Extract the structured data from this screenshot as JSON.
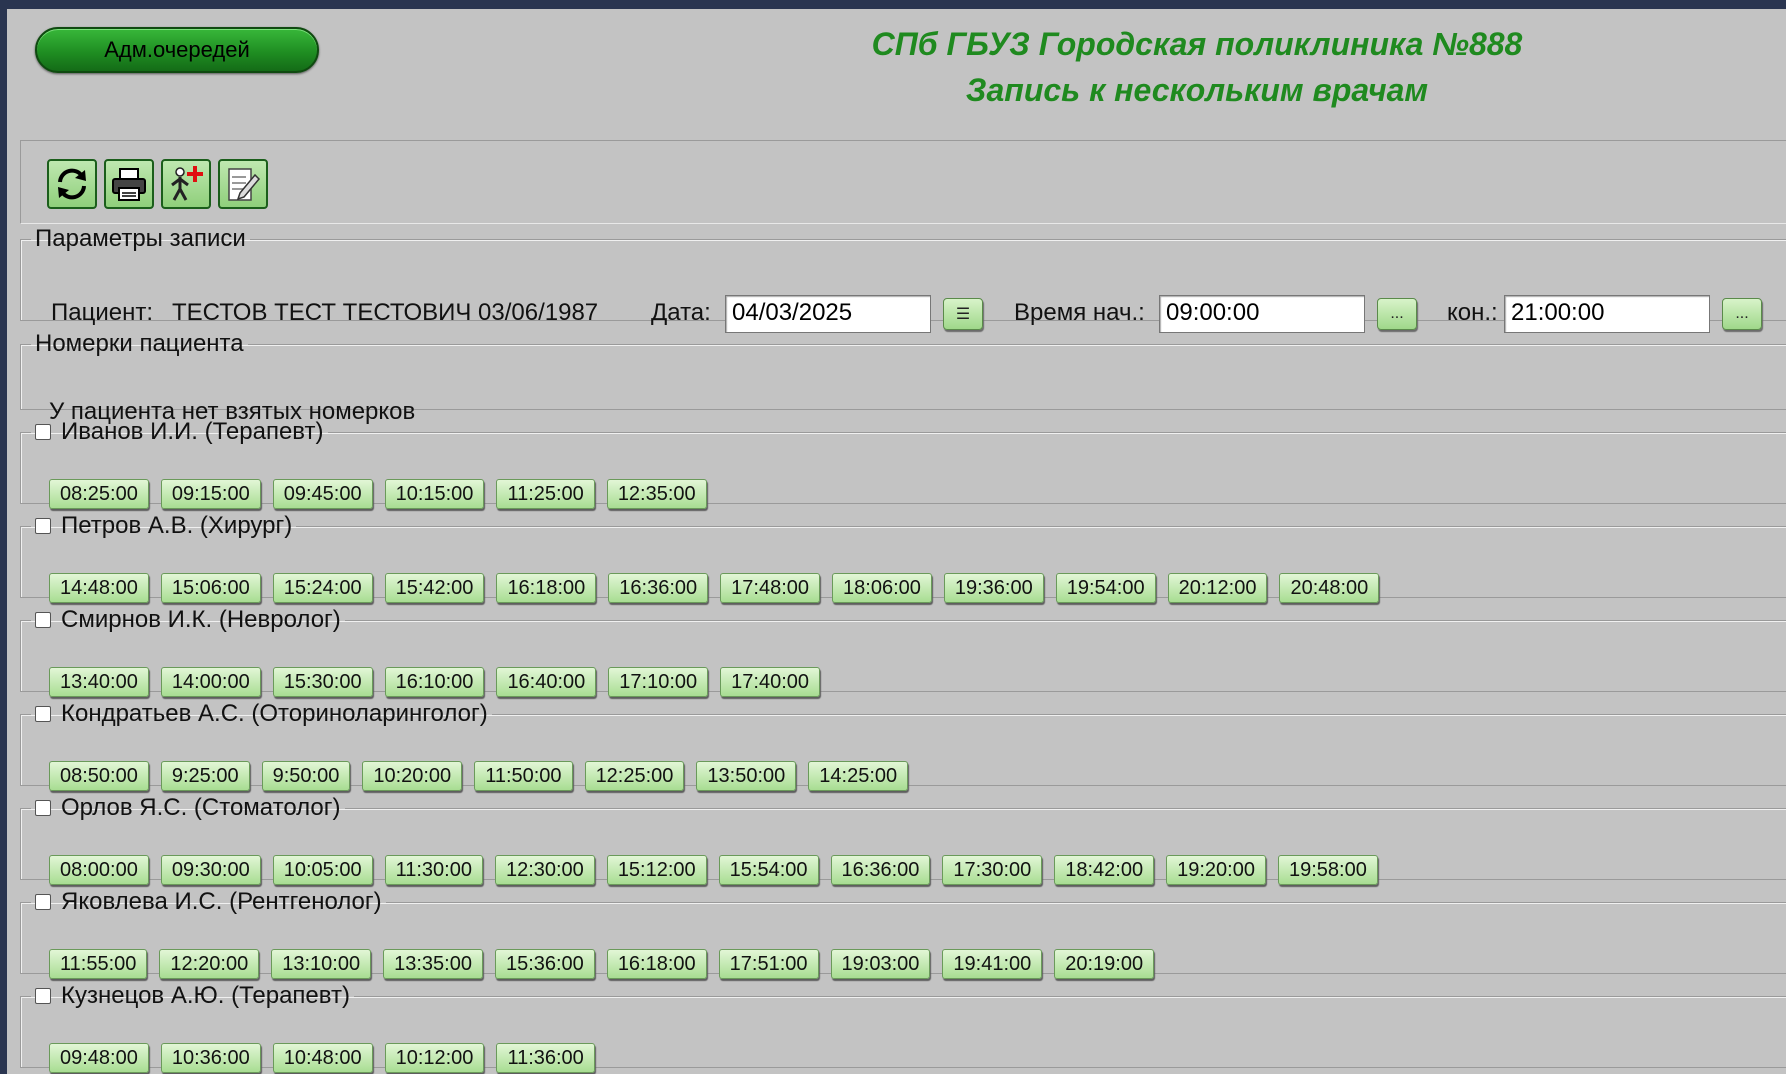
{
  "adm_button": "Адм.очередей",
  "header": {
    "line1": "СПб ГБУЗ Городская поликлиника №888",
    "line2": "Запись к нескольким врачам"
  },
  "toolbar": [
    {
      "icon": "refresh-icon"
    },
    {
      "icon": "printer-icon"
    },
    {
      "icon": "add-patient-icon"
    },
    {
      "icon": "edit-document-icon"
    }
  ],
  "params": {
    "legend": "Параметры записи",
    "patient_label": "Пациент:",
    "patient_name": "ТЕСТОВ ТЕСТ ТЕСТОВИЧ 03/06/1987",
    "date_label": "Дата:",
    "date_value": "04/03/2025",
    "date_btn": "☰",
    "start_label": "Время нач.:",
    "start_value": "09:00:00",
    "start_btn": "...",
    "end_label": "кон.:",
    "end_value": "21:00:00",
    "end_btn": "..."
  },
  "tickets": {
    "legend": "Номерки пациента",
    "message": "У пациента нет взятых номерков"
  },
  "doctors": [
    {
      "name": "Иванов И.И. (Терапевт)",
      "checked": false,
      "slots": [
        "08:25:00",
        "09:15:00",
        "09:45:00",
        "10:15:00",
        "11:25:00",
        "12:35:00"
      ]
    },
    {
      "name": "Петров А.В. (Хирург)",
      "checked": false,
      "slots": [
        "14:48:00",
        "15:06:00",
        "15:24:00",
        "15:42:00",
        "16:18:00",
        "16:36:00",
        "17:48:00",
        "18:06:00",
        "19:36:00",
        "19:54:00",
        "20:12:00",
        "20:48:00"
      ]
    },
    {
      "name": "Смирнов И.К. (Невролог)",
      "checked": false,
      "slots": [
        "13:40:00",
        "14:00:00",
        "15:30:00",
        "16:10:00",
        "16:40:00",
        "17:10:00",
        "17:40:00"
      ]
    },
    {
      "name": "Кондратьев А.С. (Оториноларинголог)",
      "checked": false,
      "slots": [
        "08:50:00",
        "9:25:00",
        "9:50:00",
        "10:20:00",
        "11:50:00",
        "12:25:00",
        "13:50:00",
        "14:25:00"
      ]
    },
    {
      "name": "Орлов Я.С. (Стоматолог)",
      "checked": false,
      "slots": [
        "08:00:00",
        "09:30:00",
        "10:05:00",
        "11:30:00",
        "12:30:00",
        "15:12:00",
        "15:54:00",
        "16:36:00",
        "17:30:00",
        "18:42:00",
        "19:20:00",
        "19:58:00"
      ]
    },
    {
      "name": "Яковлева И.С. (Рентгенолог)",
      "checked": false,
      "slots": [
        "11:55:00",
        "12:20:00",
        "13:10:00",
        "13:35:00",
        "15:36:00",
        "16:18:00",
        "17:51:00",
        "19:03:00",
        "19:41:00",
        "20:19:00"
      ]
    },
    {
      "name": "Кузнецов А.Ю. (Терапевт)",
      "checked": false,
      "slots": [
        "09:48:00",
        "10:36:00",
        "10:48:00",
        "10:12:00",
        "11:36:00"
      ]
    }
  ]
}
